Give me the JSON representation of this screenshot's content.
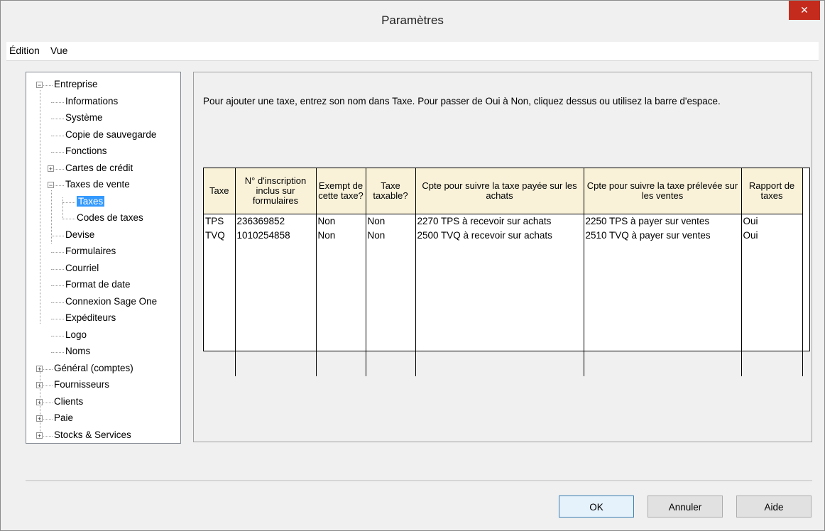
{
  "window": {
    "title": "Paramètres",
    "close_glyph": "✕"
  },
  "menu": {
    "items": [
      "Édition",
      "Vue"
    ]
  },
  "tree": {
    "nodes": [
      {
        "label": "Entreprise",
        "expander": "−"
      },
      {
        "label": "Informations"
      },
      {
        "label": "Système"
      },
      {
        "label": "Copie de sauvegarde"
      },
      {
        "label": "Fonctions"
      },
      {
        "label": "Cartes de crédit",
        "expander": "+"
      },
      {
        "label": "Taxes de vente",
        "expander": "−"
      },
      {
        "label": "Taxes",
        "selected": true
      },
      {
        "label": "Codes de taxes"
      },
      {
        "label": "Devise"
      },
      {
        "label": "Formulaires"
      },
      {
        "label": "Courriel"
      },
      {
        "label": "Format de date"
      },
      {
        "label": "Connexion Sage One"
      },
      {
        "label": "Expéditeurs"
      },
      {
        "label": "Logo"
      },
      {
        "label": "Noms"
      },
      {
        "label": "Général (comptes)",
        "expander": "+"
      },
      {
        "label": "Fournisseurs",
        "expander": "+"
      },
      {
        "label": "Clients",
        "expander": "+"
      },
      {
        "label": "Paie",
        "expander": "+"
      },
      {
        "label": "Stocks & Services",
        "expander": "+"
      }
    ]
  },
  "instructions": "Pour ajouter une taxe, entrez son nom dans Taxe. Pour passer de Oui à Non, cliquez dessus ou utilisez la barre d'espace.",
  "table": {
    "columns": [
      "Taxe",
      "N° d'inscription inclus sur formulaires",
      "Exempt de cette taxe?",
      "Taxe taxable?",
      "Cpte pour suivre la taxe payée sur les achats",
      "Cpte pour suivre la taxe prélevée sur les ventes",
      "Rapport de taxes"
    ],
    "rows": [
      [
        "TPS",
        "236369852",
        "Non",
        "Non",
        "2270 TPS à recevoir sur achats",
        "2250 TPS à payer sur ventes",
        "Oui"
      ],
      [
        "TVQ",
        "1010254858",
        "Non",
        "Non",
        "2500 TVQ à recevoir sur achats",
        "2510 TVQ à payer sur ventes",
        "Oui"
      ]
    ]
  },
  "buttons": {
    "ok": "OK",
    "cancel": "Annuler",
    "help": "Aide"
  }
}
